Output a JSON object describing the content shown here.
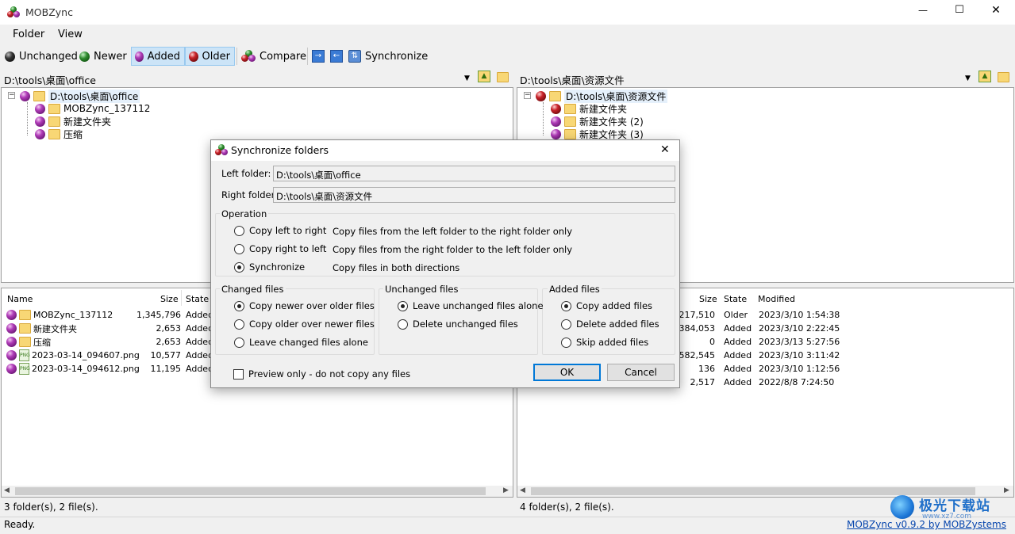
{
  "app": {
    "title": "MOBZync",
    "win_min": "—",
    "win_max": "☐",
    "win_close": "✕"
  },
  "menu": [
    "Folder",
    "View"
  ],
  "toolbar": {
    "unchanged": "Unchanged",
    "newer": "Newer",
    "added": "Added",
    "older": "Older",
    "compare": "Compare",
    "synchronize": "Synchronize"
  },
  "left": {
    "path": "D:\\tools\\桌面\\office",
    "tree": [
      {
        "label": "D:\\tools\\桌面\\office"
      },
      {
        "label": "MOBZync_137112"
      },
      {
        "label": "新建文件夹"
      },
      {
        "label": "压缩"
      }
    ],
    "headers": {
      "name": "Name",
      "size": "Size",
      "state": "State"
    },
    "rows": [
      {
        "name": "MOBZync_137112",
        "size": "1,345,796",
        "state": "Added",
        "icon": "folder"
      },
      {
        "name": "新建文件夹",
        "size": "2,653",
        "state": "Added",
        "icon": "folder"
      },
      {
        "name": "压缩",
        "size": "2,653",
        "state": "Added",
        "icon": "folder"
      },
      {
        "name": "2023-03-14_094607.png",
        "size": "10,577",
        "state": "Added",
        "icon": "png"
      },
      {
        "name": "2023-03-14_094612.png",
        "size": "11,195",
        "state": "Added",
        "icon": "png"
      }
    ],
    "status": "3 folder(s), 2 file(s)."
  },
  "right": {
    "path": "D:\\tools\\桌面\\资源文件",
    "tree": [
      {
        "label": "D:\\tools\\桌面\\资源文件"
      },
      {
        "label": "新建文件夹"
      },
      {
        "label": "新建文件夹 (2)"
      },
      {
        "label": "新建文件夹 (3)"
      }
    ],
    "headers": {
      "size": "Size",
      "state": "State",
      "modified": "Modified"
    },
    "rows": [
      {
        "size": "217,510",
        "state": "Older",
        "modified": "2023/3/10 1:54:38"
      },
      {
        "size": "384,053",
        "state": "Added",
        "modified": "2023/3/10 2:22:45"
      },
      {
        "size": "0",
        "state": "Added",
        "modified": "2023/3/13 5:27:56"
      },
      {
        "size": "582,545",
        "state": "Added",
        "modified": "2023/3/10 3:11:42"
      },
      {
        "size": "136",
        "state": "Added",
        "modified": "2023/3/10 1:12:56"
      },
      {
        "size": "2,517",
        "state": "Added",
        "modified": "2022/8/8 7:24:50"
      }
    ],
    "status": "4 folder(s), 2 file(s)."
  },
  "statusbar": {
    "ready": "Ready.",
    "link": "MOBZync v0.9.2 by MOBZystems",
    "watermark": "极光下载站",
    "watermark_url": "www.xz7.com"
  },
  "dialog": {
    "title": "Synchronize folders",
    "close": "✕",
    "left_label": "Left folder:",
    "left_value": "D:\\tools\\桌面\\office",
    "right_label": "Right folder:",
    "right_value": "D:\\tools\\桌面\\资源文件",
    "operation_label": "Operation",
    "ops": [
      {
        "label": "Copy left to right",
        "desc": "Copy files from the left folder to the right folder only",
        "checked": false
      },
      {
        "label": "Copy right to left",
        "desc": "Copy files from the right folder to the left folder only",
        "checked": false
      },
      {
        "label": "Synchronize",
        "desc": "Copy files in both directions",
        "checked": true
      }
    ],
    "changed_label": "Changed files",
    "changed": [
      "Copy newer over older files",
      "Copy older over newer files",
      "Leave changed files alone"
    ],
    "unchanged_label": "Unchanged files",
    "unchanged": [
      "Leave unchanged files alone",
      "Delete unchanged files"
    ],
    "added_label": "Added files",
    "added": [
      "Copy added files",
      "Delete added files",
      "Skip added files"
    ],
    "preview": "Preview only - do not copy any files",
    "ok": "OK",
    "cancel": "Cancel"
  }
}
